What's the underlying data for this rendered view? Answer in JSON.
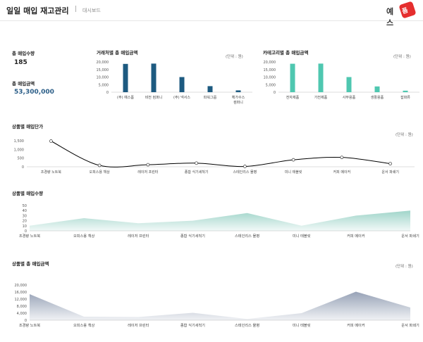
{
  "header": {
    "title": "일일 매입 재고관리",
    "separator": "|",
    "breadcrumb": "대시보드",
    "logo_text": "예스",
    "logo_badge": "폼"
  },
  "kpis": [
    {
      "label": "총 매입수량",
      "value": "185",
      "color": "#222222"
    },
    {
      "label": "총 매입금액",
      "value": "53,300,000",
      "color": "#2a5d87"
    }
  ],
  "chart_data": [
    {
      "id": "vendor",
      "type": "bar",
      "title": "거래처별 총 매입금액",
      "unit": "(단위 : 원)",
      "color": "#1d5a80",
      "categories": [
        "(주) 예스폼",
        "비전 컴퍼니",
        "(주) 넥서스",
        "파워그룹",
        [
          "헤가수스",
          "컴퍼니"
        ]
      ],
      "values": [
        18700,
        18900,
        10000,
        4000,
        1200
      ],
      "ylim": [
        0,
        20000
      ],
      "yticks": [
        "0",
        "5,000",
        "10,000",
        "15,000",
        "20,000"
      ]
    },
    {
      "id": "category",
      "type": "bar",
      "title": "카테고리별 총 매입금액",
      "unit": "(단위 : 원)",
      "color": "#4fc7b0",
      "categories": [
        "전자제품",
        "가전제품",
        "사무용품",
        "생활용품",
        "잡화류"
      ],
      "values": [
        18800,
        18900,
        10000,
        3800,
        1000
      ],
      "ylim": [
        0,
        20000
      ],
      "yticks": [
        "0",
        "5,000",
        "10,000",
        "15,000",
        "20,000"
      ]
    },
    {
      "id": "price",
      "type": "line",
      "title": "상품별 매입단가",
      "unit": "(단위 : 원)",
      "color": "#000000",
      "categories": [
        "조경량 노트북",
        "오피스용 책상",
        "레이저 프린터",
        "종합 식기세척기",
        "스테인리스 물병",
        "미니 태블릿",
        "커피 메이커",
        "운서 파쇄기"
      ],
      "values": [
        1480,
        80,
        120,
        210,
        20,
        400,
        540,
        180
      ],
      "ylim": [
        0,
        1500
      ],
      "yticks": [
        "0",
        "500",
        "1,000",
        "1,500"
      ]
    },
    {
      "id": "qty",
      "type": "area",
      "title": "상품별 매입수량",
      "unit": "",
      "color": "#8fcdc0",
      "categories": [
        "조경량 노트북",
        "오피스용 책상",
        "레이저 프린터",
        "종합 식기세척기",
        "스테인리스 물병",
        "미니 태블릿",
        "커피 메이커",
        "운서 파쇄기"
      ],
      "values": [
        10,
        25,
        15,
        20,
        35,
        10,
        30,
        40
      ],
      "ylim": [
        0,
        50
      ],
      "yticks": [
        "0",
        "10",
        "20",
        "30",
        "40",
        "50"
      ]
    },
    {
      "id": "amount",
      "type": "area",
      "title": "상품별 총 매입금액",
      "unit": "(단위 : 원)",
      "color": "#8592aa",
      "categories": [
        "조경량 노트북",
        "오피스용 책상",
        "레이저 프린터",
        "종합 식기세척기",
        "스테인리스 물병",
        "미니 태블릿",
        "커피 메이커",
        "운서 파쇄기"
      ],
      "values": [
        14800,
        2000,
        1800,
        4200,
        700,
        4000,
        16200,
        7200
      ],
      "ylim": [
        0,
        20000
      ],
      "yticks": [
        "0",
        "4,000",
        "8,000",
        "12,000",
        "16,000",
        "20,000"
      ]
    }
  ]
}
